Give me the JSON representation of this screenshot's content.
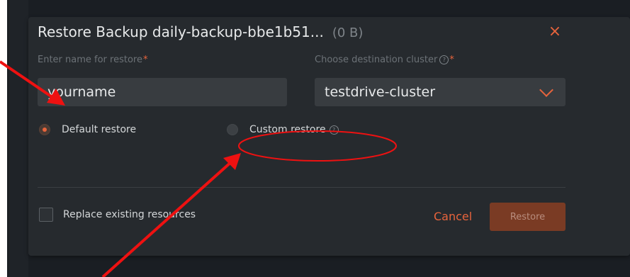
{
  "dialog": {
    "title": "Restore Backup daily-backup-bbe1b51...",
    "size": "(0 B)",
    "close_symbol": "×",
    "name_label": "Enter name for restore",
    "name_required": "*",
    "name_value": "yourname",
    "cluster_label": "Choose destination cluster",
    "cluster_help_symbol": "?",
    "cluster_required": "*",
    "cluster_value": "testdrive-cluster",
    "default_restore_label": "Default restore",
    "custom_restore_label": "Custom restore",
    "custom_help_symbol": "?",
    "replace_label": "Replace existing resources",
    "cancel_label": "Cancel",
    "restore_label": "Restore"
  },
  "colors": {
    "accent": "#e8643c",
    "annotation": "#ee1111",
    "dialog_bg": "#262a2e"
  },
  "icons": {
    "close": "close-icon",
    "cluster_help": "help-circle-icon",
    "custom_help": "help-circle-icon",
    "dropdown": "chevron-down-icon"
  },
  "state": {
    "selected_restore": "Default restore",
    "replace_checked": false
  }
}
